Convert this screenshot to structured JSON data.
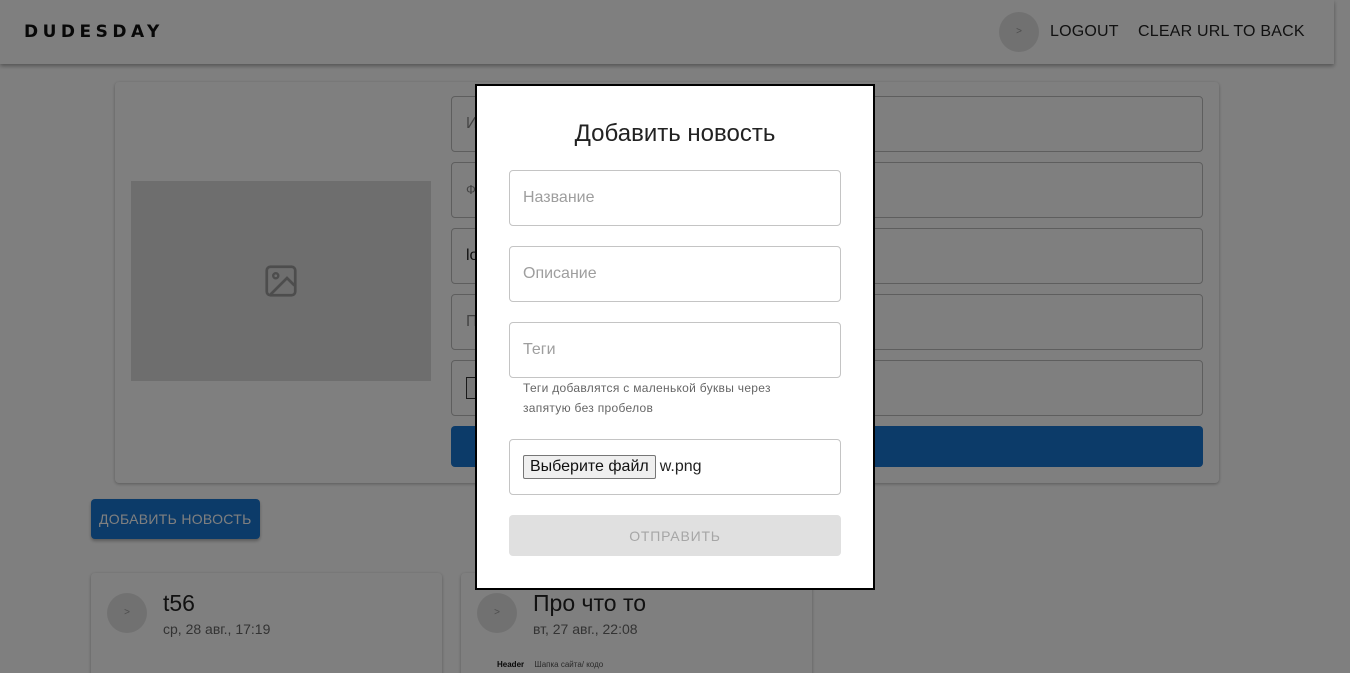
{
  "header": {
    "brand": "DUDESDAY",
    "avatar_glyph": ">",
    "logout_label": "LOGOUT",
    "clear_url_label": "CLEAR URL TO BACK"
  },
  "profile_form": {
    "fields": [
      "И",
      "Ф",
      "lo",
      "П",
      ""
    ]
  },
  "add_news_button_label": "ДОБАВИТЬ НОВОСТЬ",
  "news": [
    {
      "title": "t56",
      "date": "ср, 28 авг., 17:19"
    },
    {
      "title": "Про что то",
      "date": "вт, 27 авг., 22:08",
      "snippet_heading": "Header",
      "snippet_text": "Шапка сайта/ кодо"
    }
  ],
  "modal": {
    "title": "Добавить новость",
    "name_placeholder": "Название",
    "description_placeholder": "Описание",
    "tags_placeholder": "Теги",
    "tags_helper": "Теги добавлятся с маленькой буквы через запятую без пробелов",
    "file_button_label": "Выберите файл",
    "file_name": "w.png",
    "submit_label": "ОТПРАВИТЬ"
  },
  "colors": {
    "primary": "#1976d2",
    "overlay": "rgba(0,0,0,0.5)",
    "disabled_bg": "#e0e0e0"
  }
}
